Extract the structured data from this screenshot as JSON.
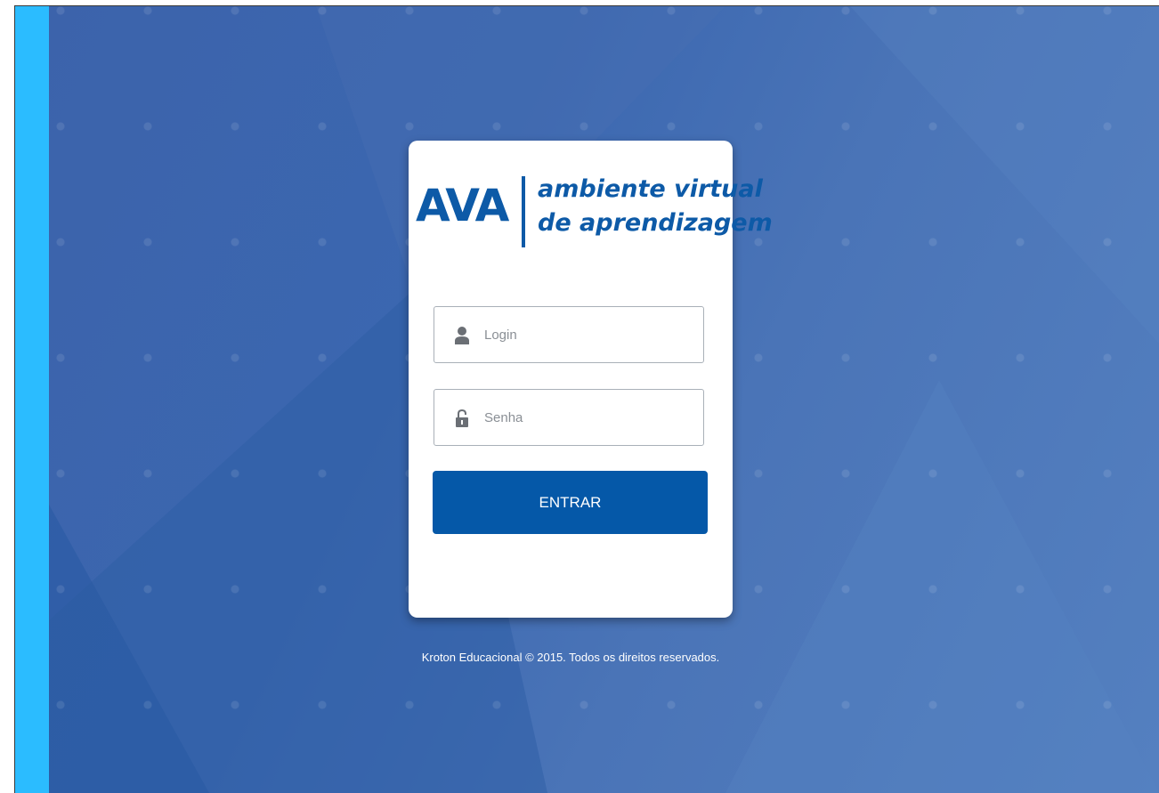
{
  "logo": {
    "brand": "AVA",
    "tagline_line1": "ambiente virtual",
    "tagline_line2": "de aprendizagem"
  },
  "login_form": {
    "login_placeholder": "Login",
    "login_icon": "user-icon",
    "password_placeholder": "Senha",
    "password_icon": "lock-icon",
    "submit_label": "ENTRAR"
  },
  "footer": {
    "text": "Kroton Educacional © 2015. Todos os direitos reservados."
  },
  "colors": {
    "accent_strip": "#2bbcff",
    "background": "#3f68ae",
    "brand_blue": "#0d5aa7",
    "button": "#0558a8"
  }
}
